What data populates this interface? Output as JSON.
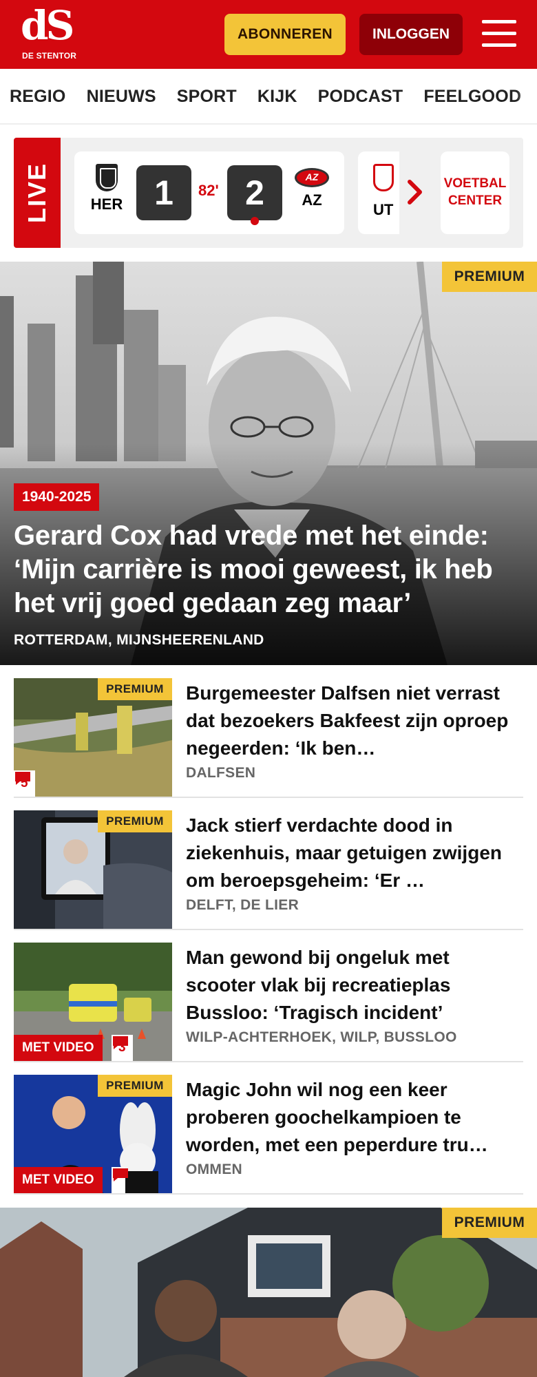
{
  "header": {
    "logo_text": "dS",
    "logo_sub": "DE STENTOR",
    "subscribe_label": "ABONNEREN",
    "login_label": "INLOGGEN"
  },
  "nav": {
    "items": [
      "REGIO",
      "NIEUWS",
      "SPORT",
      "KIJK",
      "PODCAST",
      "FEELGOOD"
    ]
  },
  "live": {
    "label": "LIVE",
    "match": {
      "home": "HER",
      "home_score": "1",
      "minute": "82'",
      "away_score": "2",
      "away": "AZ"
    },
    "next_team": "UT",
    "center_label_1": "VOETBAL",
    "center_label_2": "CENTER"
  },
  "hero": {
    "premium": "PREMIUM",
    "kicker": "1940-2025",
    "title": "Gerard Cox had vrede met het einde: ‘Mijn carrière is mooi geweest, ik heb het vrij goed gedaan zeg maar’",
    "location": "ROTTERDAM, MIJNSHEERENLAND"
  },
  "articles": [
    {
      "premium": "PREMIUM",
      "comments": "5",
      "title": "Burgemeester Dalfsen niet verrast dat bezoekers Bakfeest zijn oproep negeerden: ‘Ik ben…",
      "location": "DALFSEN"
    },
    {
      "premium": "PREMIUM",
      "title": "Jack stierf verdachte dood in ziekenhuis, maar getuigen zwijgen om beroepsgeheim: ‘Er …",
      "location": "DELFT, DE LIER"
    },
    {
      "video": "MET VIDEO",
      "comments": "3",
      "title": "Man gewond bij ongeluk met scooter vlak bij recreatieplas Bussloo: ‘Tragisch incident’",
      "location": "WILP-ACHTERHOEK, WILP, BUSSLOO"
    },
    {
      "premium": "PREMIUM",
      "video": "MET VIDEO",
      "title": "Magic John wil nog een keer proberen goochelkampioen te worden, met een peperdure tru…",
      "location": "OMMEN"
    }
  ],
  "hero2": {
    "premium": "PREMIUM"
  },
  "colors": {
    "brand_red": "#d3080f",
    "premium_yellow": "#f3c438",
    "login_dark_red": "#8e0007"
  }
}
